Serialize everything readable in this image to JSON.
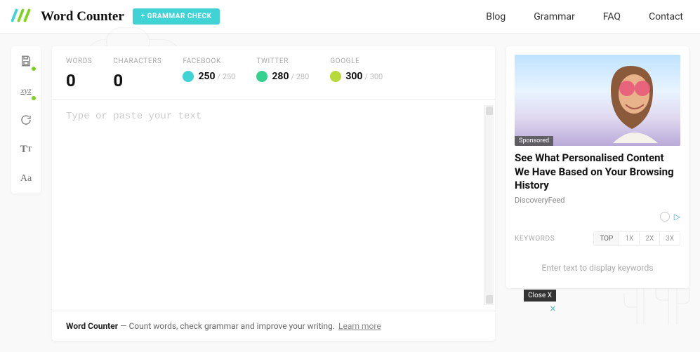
{
  "header": {
    "title": "Word Counter",
    "grammar_badge": "+ GRAMMAR CHECK",
    "nav": {
      "blog": "Blog",
      "grammar": "Grammar",
      "faq": "FAQ",
      "contact": "Contact"
    }
  },
  "toolbar": {
    "save": "save-icon",
    "spellcheck": "xyz",
    "sync": "↻",
    "font_size": "Tᴛ",
    "font_face": "Aa"
  },
  "stats": {
    "words": {
      "label": "WORDS",
      "value": "0"
    },
    "characters": {
      "label": "CHARACTERS",
      "value": "0"
    },
    "facebook": {
      "label": "FACEBOOK",
      "value": "250",
      "max": "/ 250",
      "color": "#3fd3d6"
    },
    "twitter": {
      "label": "TWITTER",
      "value": "280",
      "max": "/ 280",
      "color": "#33d28f"
    },
    "google": {
      "label": "GOOGLE",
      "value": "300",
      "max": "/ 300",
      "color": "#b8d93a"
    }
  },
  "editor": {
    "placeholder": "Type or paste your text",
    "value": ""
  },
  "footer": {
    "brand": "Word Counter",
    "sep": "  —  ",
    "tagline": "Count words, check grammar and improve your writing.",
    "learn": "Learn more"
  },
  "sidebar": {
    "sponsored": "Sponsored",
    "ad_title": "See What Personalised Content We Have Based on Your Browsing History",
    "ad_source": "DiscoveryFeed",
    "keywords_label": "KEYWORDS",
    "tabs": {
      "top": "TOP",
      "x1": "1X",
      "x2": "2X",
      "x3": "3X"
    },
    "empty": "Enter text to display keywords"
  },
  "close": {
    "label": "Close X",
    "x": "✕"
  }
}
